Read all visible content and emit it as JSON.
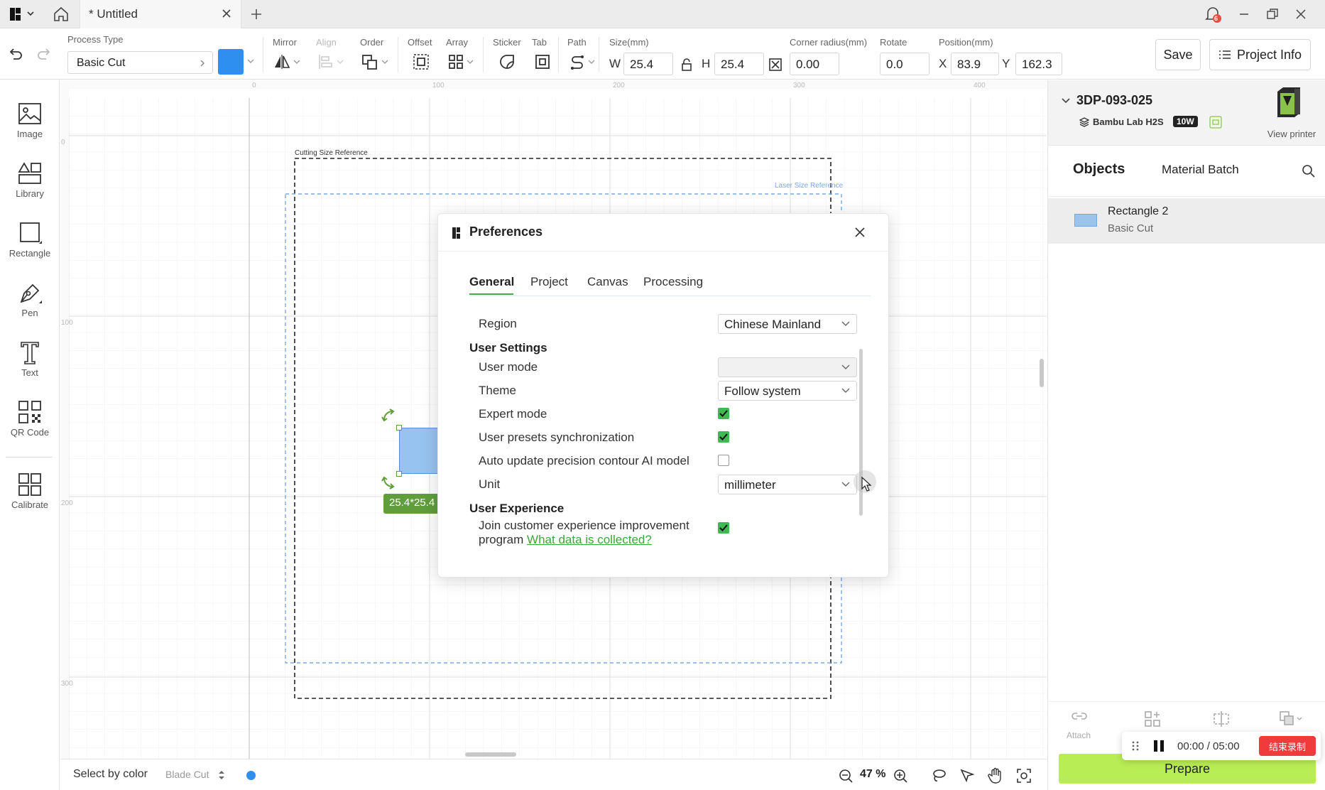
{
  "titlebar": {
    "tab_title": "* Untitled",
    "notification_count": "6"
  },
  "toolbar": {
    "process_type_label": "Process Type",
    "process_type_value": "Basic Cut",
    "process_color": "#2f8ff0",
    "mirror_label": "Mirror",
    "align_label": "Align",
    "order_label": "Order",
    "offset_label": "Offset",
    "array_label": "Array",
    "sticker_label": "Sticker",
    "tab_label": "Tab",
    "path_label": "Path",
    "size_label": "Size(mm)",
    "w_label": "W",
    "w_value": "25.4",
    "h_label": "H",
    "h_value": "25.4",
    "corner_label": "Corner radius(mm)",
    "corner_value": "0.00",
    "rotate_label": "Rotate",
    "rotate_value": "0.0",
    "position_label": "Position(mm)",
    "x_label": "X",
    "x_value": "83.9",
    "y_label": "Y",
    "y_value": "162.3",
    "save_label": "Save",
    "project_info_label": "Project Info"
  },
  "sidebar": {
    "items": [
      {
        "label": "Image",
        "icon": "image-icon"
      },
      {
        "label": "Library",
        "icon": "library-icon"
      },
      {
        "label": "Rectangle",
        "icon": "rectangle-icon"
      },
      {
        "label": "Pen",
        "icon": "pen-icon"
      },
      {
        "label": "Text",
        "icon": "text-icon"
      },
      {
        "label": "QR Code",
        "icon": "qr-code-icon"
      },
      {
        "label": "Calibrate",
        "icon": "calibrate-icon"
      }
    ]
  },
  "canvas": {
    "ruler_top": [
      "0",
      "100",
      "200",
      "300",
      "400"
    ],
    "ruler_left": [
      "0",
      "100",
      "200",
      "300"
    ],
    "cutting_label": "Cutting Size Reference",
    "laser_label": "Laser Size Reference",
    "size_badge": "25.4*25.4"
  },
  "statusbar": {
    "select_by_color": "Select by color",
    "blade_cut": "Blade Cut",
    "zoom": "47 %"
  },
  "right": {
    "printer_name": "3DP-093-025",
    "printer_model": "Bambu Lab H2S",
    "laser_badge": "10W",
    "view_printer": "View printer",
    "tab_objects": "Objects",
    "tab_material": "Material Batch",
    "object_name": "Rectangle 2",
    "object_process": "Basic Cut",
    "object_color": "#9cc3ec",
    "attach_label": "Attach",
    "prepare_label": "Prepare"
  },
  "recording": {
    "time": "00:00 / 05:00",
    "stop_label": "结束录制"
  },
  "dialog": {
    "title": "Preferences",
    "tabs": [
      "General",
      "Project",
      "Canvas",
      "Processing"
    ],
    "region_label": "Region",
    "region_value": "Chinese Mainland",
    "user_settings": "User Settings",
    "user_mode_label": "User mode",
    "user_mode_value": "",
    "theme_label": "Theme",
    "theme_value": "Follow system",
    "expert_mode_label": "Expert mode",
    "expert_mode_checked": true,
    "presets_sync_label": "User presets synchronization",
    "presets_sync_checked": true,
    "auto_update_label": "Auto update precision contour AI model",
    "auto_update_checked": false,
    "unit_label": "Unit",
    "unit_value": "millimeter",
    "user_experience": "User Experience",
    "join_program_line1": "Join customer experience improvement",
    "join_program_line2": "program",
    "what_data_link": "What data is collected?",
    "join_checked": true
  },
  "colors": {
    "accent_green": "#3fb950",
    "prepare_green": "#b8ed55",
    "laser_blue": "#7aa8e0"
  }
}
